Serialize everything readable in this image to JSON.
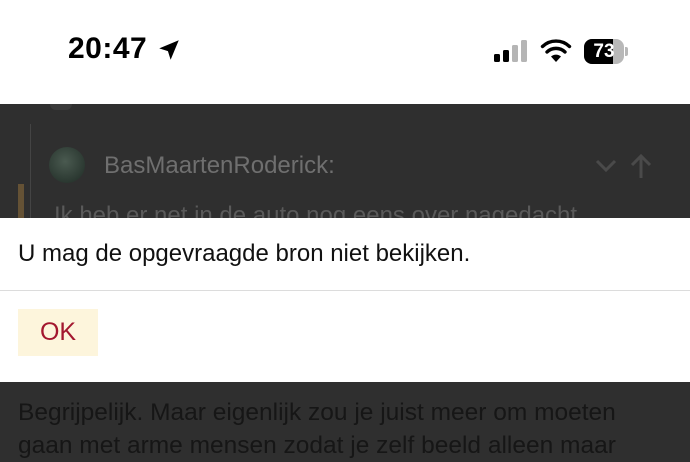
{
  "status_bar": {
    "time": "20:47",
    "battery_percent": "73",
    "battery_level": 0.73,
    "signal_bars_active": 2,
    "signal_bars_total": 4,
    "icons": [
      "location-arrow-icon",
      "cellular-signal-icon",
      "wifi-icon",
      "battery-icon"
    ]
  },
  "background": {
    "quote_author": "BasMaartenRoderick:",
    "quote_text_partial": "Ik heb er net in de auto nog eens over nagedacht",
    "paragraph_lines": [
      "Begrijpelijk. Maar eigenlijk zou je juist meer om moeten",
      "gaan met arme mensen zodat je zelf beeld alleen maar"
    ],
    "icons": [
      "chevron-down-icon",
      "arrow-up-icon"
    ]
  },
  "dialog": {
    "message": "U mag de opgevraagde bron niet bekijken.",
    "ok_label": "OK"
  },
  "colors": {
    "accent": "#a3172f",
    "ok_button_bg": "#fdf5dc",
    "overlay_bg": "#2f2f2f"
  }
}
